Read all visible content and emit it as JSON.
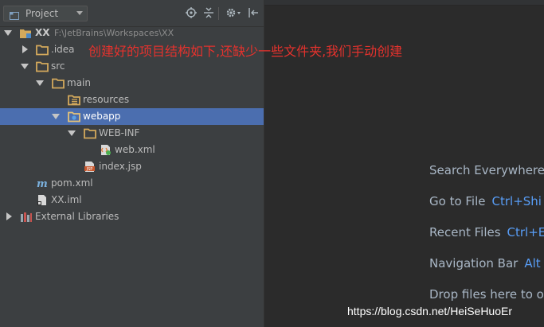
{
  "panel": {
    "title": "Project",
    "tools": [
      "crosshair-icon",
      "collapse-all-icon",
      "gear-icon",
      "hide-panel-icon"
    ]
  },
  "tree": {
    "root": {
      "label": "XX",
      "path": "F:\\JetBrains\\Workspaces\\XX"
    },
    "idea": {
      "label": ".idea"
    },
    "src": {
      "label": "src"
    },
    "main": {
      "label": "main"
    },
    "resources": {
      "label": "resources"
    },
    "webapp": {
      "label": "webapp"
    },
    "webinf": {
      "label": "WEB-INF"
    },
    "webxml": {
      "label": "web.xml"
    },
    "indexjsp": {
      "label": "index.jsp"
    },
    "pom": {
      "label": "pom.xml"
    },
    "xximl": {
      "label": "XX.iml"
    },
    "extlibs": {
      "label": "External Libraries"
    }
  },
  "annotation": "创建好的项目结构如下,还缺少一些文件夹,我们手动创建",
  "editor": {
    "hints": {
      "search": {
        "label": "Search Everywhere",
        "key": ""
      },
      "goto": {
        "label": "Go to File",
        "key": "Ctrl+Shi"
      },
      "recent": {
        "label": "Recent Files",
        "key": "Ctrl+E"
      },
      "nav": {
        "label": "Navigation Bar",
        "key": "Alt"
      },
      "drop": {
        "label": "Drop files here to o",
        "key": ""
      }
    }
  },
  "watermark": "https://blog.csdn.net/HeiSeHuoEr",
  "colors": {
    "panel_bg": "#3c3f41",
    "editor_bg": "#2b2b2b",
    "selection": "#4b6eaf",
    "annotation": "#e5322d",
    "shortcut": "#589df6",
    "folder": "#d3a95c"
  }
}
